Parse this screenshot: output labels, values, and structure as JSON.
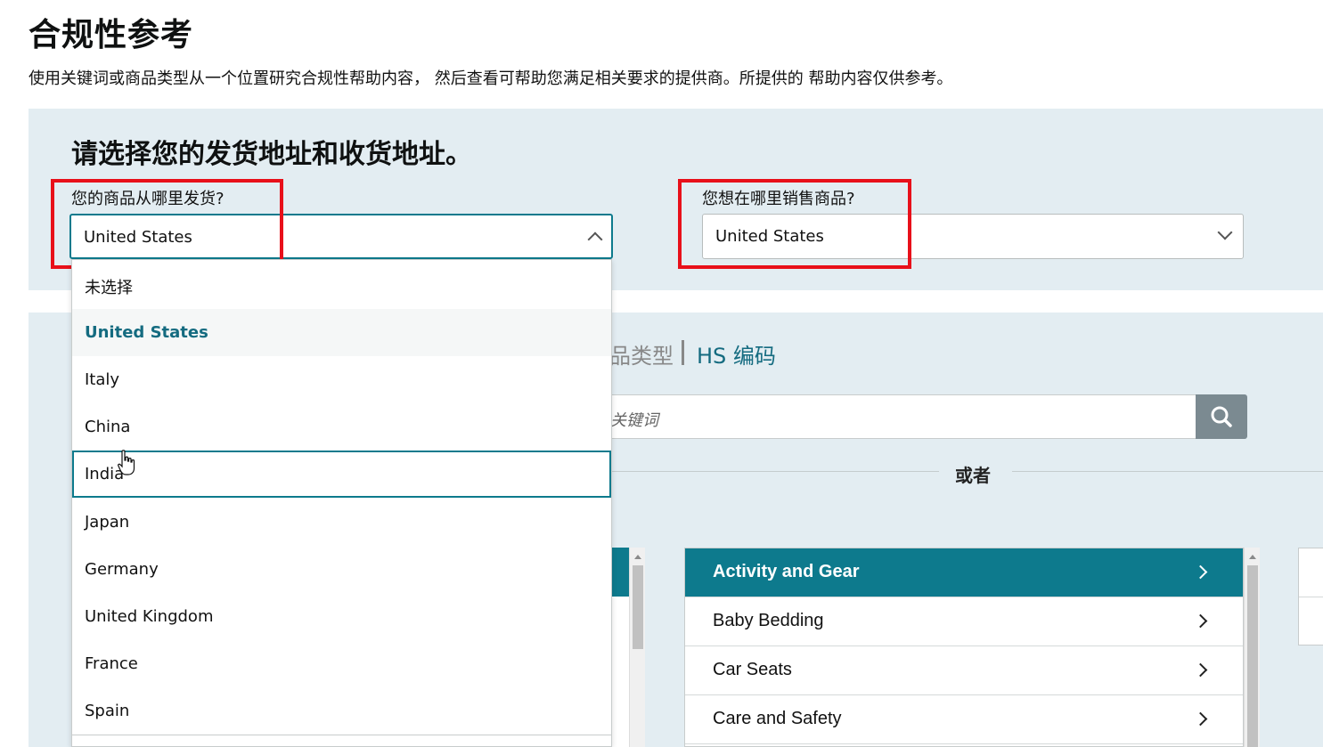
{
  "header": {
    "title": "合规性参考",
    "description": "使用关键词或商品类型从一个位置研究合规性帮助内容， 然后查看可帮助您满足相关要求的提供商。所提供的 帮助内容仅供参考。"
  },
  "address_panel": {
    "heading": "请选择您的发货地址和收货地址。",
    "ship_from": {
      "label": "您的商品从哪里发货?",
      "value": "United States",
      "open": true
    },
    "sell_to": {
      "label": "您想在哪里销售商品?",
      "value": "United States"
    }
  },
  "ship_from_dropdown": {
    "options": [
      "未选择",
      "United States",
      "Italy",
      "China",
      "India",
      "Japan",
      "Germany",
      "United Kingdom",
      "France",
      "Spain"
    ],
    "selected": "United States",
    "hovered": "India"
  },
  "search_panel": {
    "tab_partial": "品类型",
    "tab_hs": "HS 编码",
    "search_placeholder": "关键词",
    "or_text": "或者",
    "search_icon": "search-icon"
  },
  "categories": [
    {
      "label": "Activity and Gear",
      "active": true
    },
    {
      "label": "Baby Bedding",
      "active": false
    },
    {
      "label": "Car Seats",
      "active": false
    },
    {
      "label": "Care and Safety",
      "active": false
    }
  ],
  "colors": {
    "accent": "#0d7a8d",
    "panel_bg": "#e3edf2",
    "highlight": "#e8101a",
    "link": "#146b80"
  }
}
